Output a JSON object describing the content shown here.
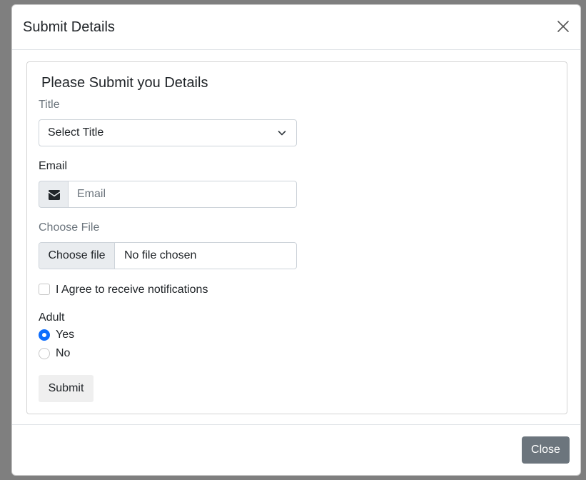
{
  "modal": {
    "title": "Submit Details",
    "close_icon": "close-icon"
  },
  "form": {
    "heading": "Please Submit you Details",
    "title_label": "Title",
    "title_select": {
      "selected": "Select Title",
      "icon": "chevron-down-icon"
    },
    "email_label": "Email",
    "email_input": {
      "placeholder": "Email",
      "value": "",
      "icon": "envelope-icon"
    },
    "file_label": "Choose File",
    "file_input": {
      "button_label": "Choose file",
      "status": "No file chosen"
    },
    "notifications_checkbox": {
      "label": "I Agree to receive notifications",
      "checked": false
    },
    "adult_label": "Adult",
    "adult_options": [
      {
        "label": "Yes",
        "checked": true
      },
      {
        "label": "No",
        "checked": false
      }
    ],
    "submit_label": "Submit"
  },
  "footer": {
    "close_label": "Close"
  },
  "colors": {
    "backdrop": "#7f7f7f",
    "accent": "#0d6efd",
    "secondary_button": "#6c757d",
    "muted_text": "#6c757d"
  }
}
